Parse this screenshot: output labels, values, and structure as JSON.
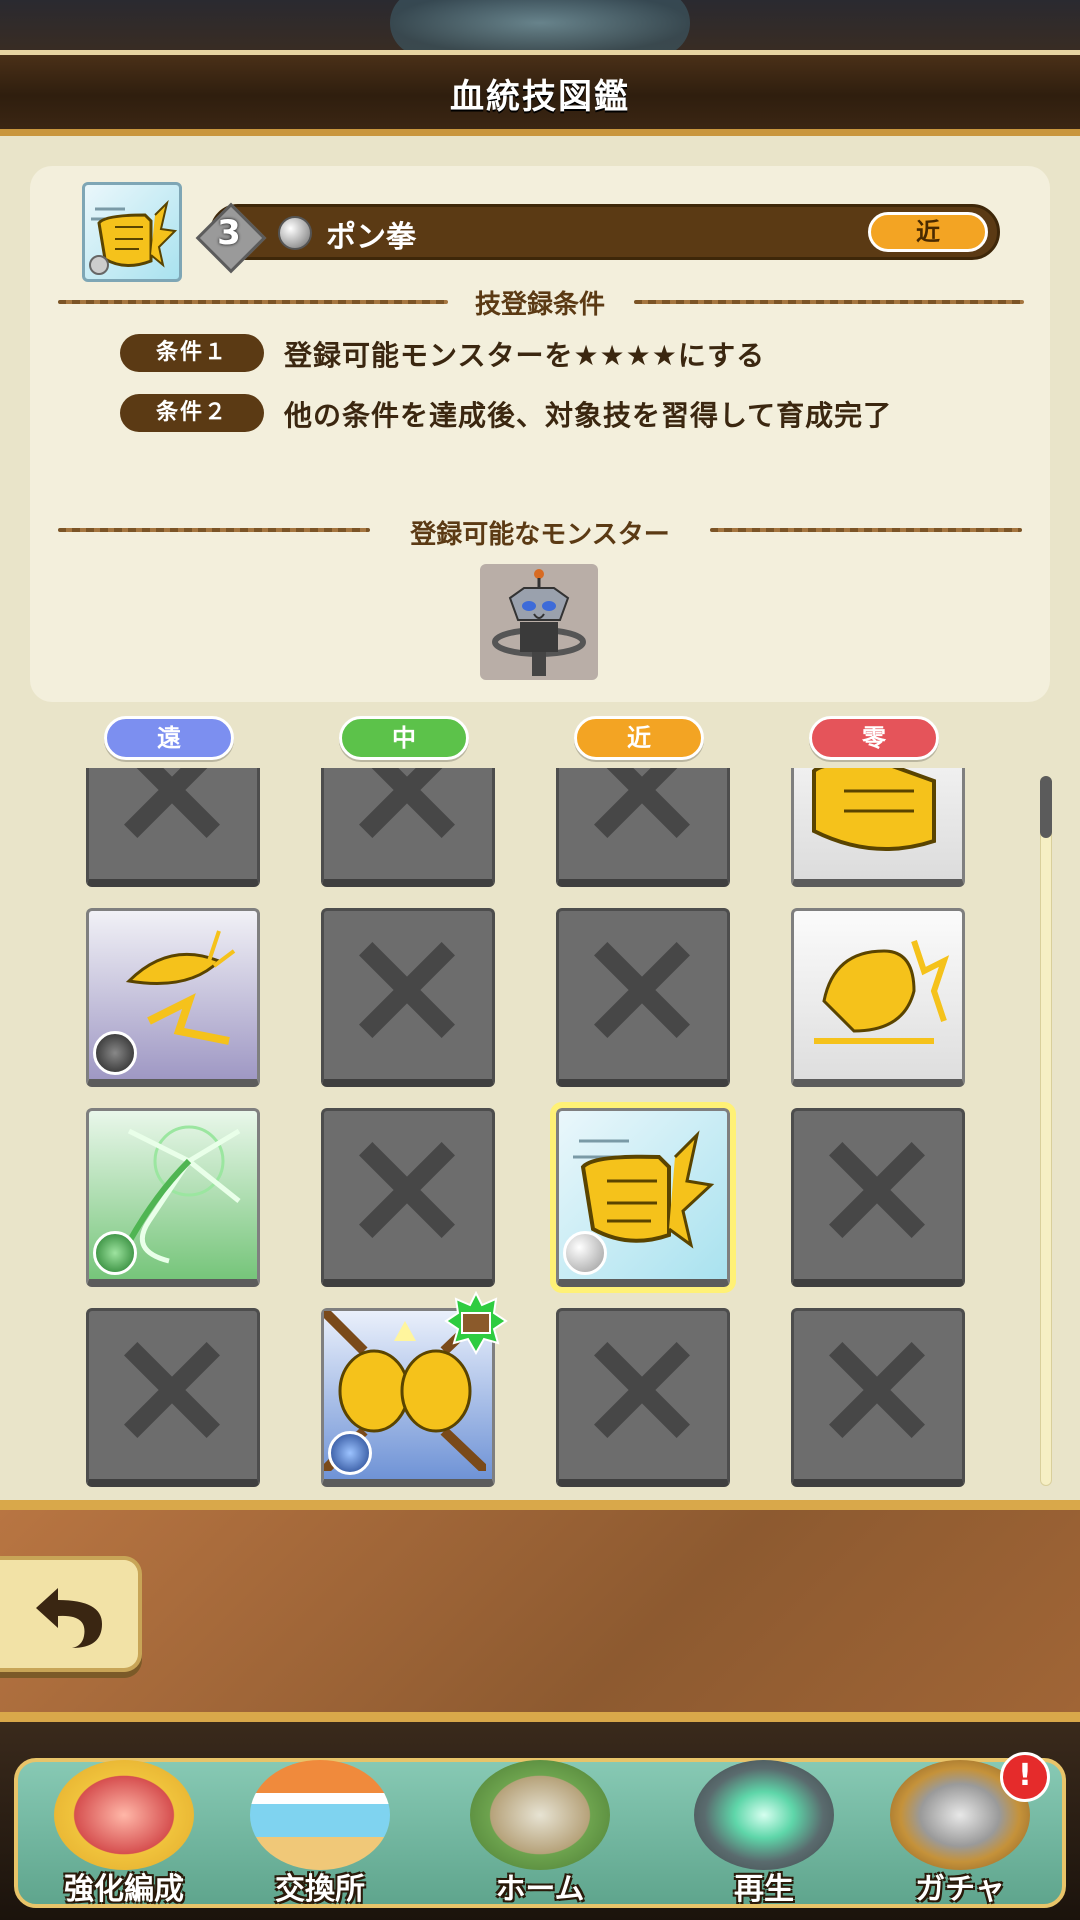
{
  "header": {
    "title": "血統技図鑑"
  },
  "skill": {
    "level": "3",
    "name": "ポン拳",
    "range": "近"
  },
  "conditions": {
    "section_title": "技登録条件",
    "items": [
      {
        "label": "条件１",
        "text": "登録可能モンスターを★★★★にする"
      },
      {
        "label": "条件２",
        "text": "他の条件を達成後、対象技を習得して育成完了"
      }
    ]
  },
  "monsters": {
    "section_title": "登録可能なモンスター"
  },
  "tabs": [
    {
      "label": "遠",
      "color": "#7c8ff0"
    },
    {
      "label": "中",
      "color": "#5cc24a"
    },
    {
      "label": "近",
      "color": "#f3a423"
    },
    {
      "label": "零",
      "color": "#e5545a"
    }
  ],
  "grid": {
    "rows": [
      [
        "locked",
        "locked",
        "locked",
        "fist-partial"
      ],
      [
        "dark-burst",
        "locked",
        "locked",
        "yellow-creature"
      ],
      [
        "green-beam",
        "locked",
        "pon-fist",
        "locked"
      ],
      [
        "locked",
        "double-fist",
        "locked",
        "locked"
      ]
    ],
    "selected": "pon-fist"
  },
  "nav": [
    {
      "label": "強化編成",
      "icon": "monster-team-icon"
    },
    {
      "label": "交換所",
      "icon": "shop-icon"
    },
    {
      "label": "ホーム",
      "icon": "home-island-icon"
    },
    {
      "label": "再生",
      "icon": "revive-altar-icon"
    },
    {
      "label": "ガチャ",
      "icon": "gacha-machine-icon",
      "alert": "!"
    }
  ]
}
